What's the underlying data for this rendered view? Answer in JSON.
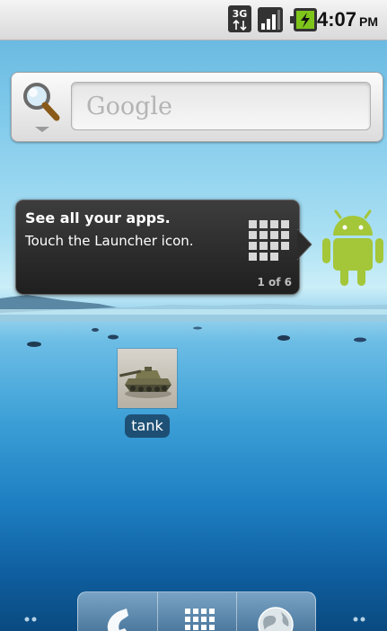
{
  "status_bar": {
    "network_icon": "3g-data-icon",
    "signal_icon": "signal-strength-icon",
    "battery_icon": "battery-charging-icon",
    "time": "4:07",
    "ampm": "PM"
  },
  "search_widget": {
    "icon": "magnifier-icon",
    "placeholder": "Google"
  },
  "launcher_tip": {
    "title": "See all your apps.",
    "body": "Touch the Launcher icon.",
    "counter": "1 of 6",
    "icon": "app-grid-icon",
    "mascot": "android-mascot-icon"
  },
  "shortcut": {
    "label": "tank",
    "icon": "tank-image"
  },
  "dock": {
    "items": [
      {
        "name": "phone-icon"
      },
      {
        "name": "launcher-grid-icon"
      },
      {
        "name": "browser-globe-icon"
      }
    ]
  },
  "colors": {
    "status_bar": "#d9d9d9",
    "tooltip_bg": "#2a2a2a",
    "android_green": "#a4c639",
    "label_bg": "#1e3c5a"
  }
}
